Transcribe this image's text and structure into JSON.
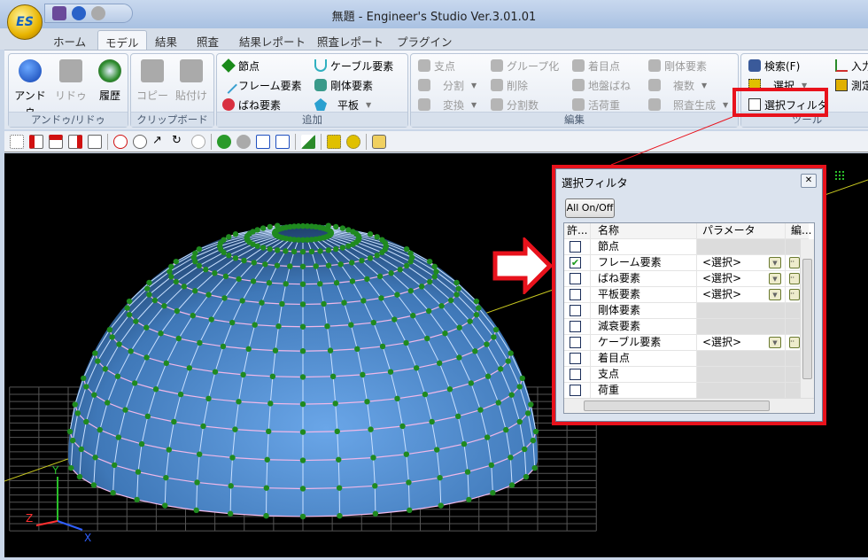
{
  "app": {
    "title": "無題 - Engineer's Studio Ver.3.01.01",
    "logo": "ES"
  },
  "tabs": [
    "ホーム",
    "モデル",
    "結果",
    "照査",
    "結果レポート",
    "照査レポート",
    "プラグイン"
  ],
  "active_tab": "モデル",
  "ribbon": {
    "undo_group": {
      "label": "アンドゥ/リドゥ",
      "undo": "アンドゥ",
      "redo": "リドゥ",
      "history": "履歴"
    },
    "clipboard_group": {
      "label": "クリップボード",
      "copy": "コピー",
      "paste": "貼付け"
    },
    "add_group": {
      "label": "追加",
      "node": "節点",
      "frame": "フレーム要素",
      "spring": "ばね要素",
      "cable": "ケーブル要素",
      "rigid": "剛体要素",
      "plate": "平板"
    },
    "edit_group": {
      "label": "編集",
      "support": "支点",
      "divide": "分割",
      "transform": "変換",
      "group": "グループ化",
      "delete": "削除",
      "divcount": "分割数",
      "focus": "着目点",
      "ground_spring": "地盤ばね",
      "live_load": "活荷重",
      "rigid": "剛体要素",
      "multiple": "複数",
      "check_gen": "照査生成"
    },
    "tool_group": {
      "label": "ツール",
      "search": "検索(F)",
      "select": "選択",
      "select_filter": "選択フィルタ",
      "input": "入力",
      "measure": "測定"
    }
  },
  "dialog": {
    "title": "選択フィルタ",
    "all_button": "All On/Off",
    "columns": [
      "許...",
      "名称",
      "パラメータ",
      "編..."
    ],
    "rows": [
      {
        "name": "節点",
        "checked": false,
        "param": ""
      },
      {
        "name": "フレーム要素",
        "checked": true,
        "param": "<選択>"
      },
      {
        "name": "ばね要素",
        "checked": false,
        "param": "<選択>"
      },
      {
        "name": "平板要素",
        "checked": false,
        "param": "<選択>"
      },
      {
        "name": "剛体要素",
        "checked": false,
        "param": ""
      },
      {
        "name": "減衰要素",
        "checked": false,
        "param": ""
      },
      {
        "name": "ケーブル要素",
        "checked": false,
        "param": "<選択>"
      },
      {
        "name": "着目点",
        "checked": false,
        "param": ""
      },
      {
        "name": "支点",
        "checked": false,
        "param": ""
      },
      {
        "name": "荷重",
        "checked": false,
        "param": ""
      }
    ]
  },
  "axes": {
    "x": "X",
    "y": "Y",
    "z": "Z"
  },
  "colors": {
    "highlight": "#e8121c",
    "dome": "#4a86c8",
    "node": "#1f8a1f"
  }
}
